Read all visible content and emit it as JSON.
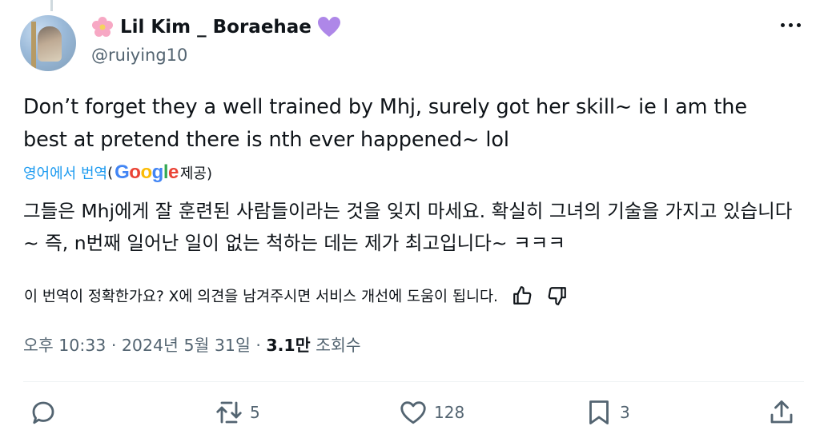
{
  "user": {
    "display_name": "Lil Kim _ Boraehae",
    "handle": "@ruiying10",
    "avatar_icon": "avatar-photo",
    "name_prefix_icon": "cherry-blossom-icon",
    "name_suffix_icon": "purple-heart-icon"
  },
  "tweet": {
    "text": "Don’t forget they a well trained by Mhj, surely got her skill~ ie I  am the best at pretend there is nth ever happened~ lol"
  },
  "translation": {
    "link_label": "영어에서 번역",
    "open_paren": "(",
    "provider": "Google",
    "provided_by": " 제공)",
    "text": "그들은 Mhj에게 잘 훈련된 사람들이라는 것을 잊지 마세요. 확실히 그녀의 기술을 가지고 있습니다~ 즉, n번째 일어난 일이 없는 척하는 데는 제가 최고입니다~ ㅋㅋㅋ",
    "feedback_prompt": "이 번역이 정확한가요? X에 의견을 남겨주시면 서비스 개선에 도움이 됩니다."
  },
  "meta": {
    "time": "오후 10:33",
    "separator": " · ",
    "date": "2024년 5월 31일",
    "views_count": "3.1만",
    "views_label": " 조회수"
  },
  "actions": {
    "reply_count": "",
    "retweet_count": "5",
    "like_count": "128",
    "bookmark_count": "3"
  },
  "colors": {
    "accent": "#1d9bf0",
    "text": "#0f1419",
    "secondary": "#536471"
  }
}
